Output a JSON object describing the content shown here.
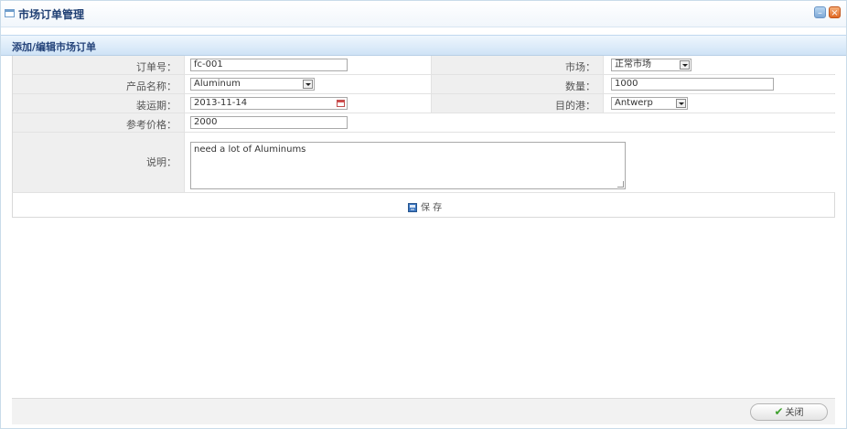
{
  "window": {
    "title": "市场订单管理"
  },
  "section": {
    "title": "添加/编辑市场订单"
  },
  "form": {
    "order_no": {
      "label": "订单号：",
      "value": "fc-001"
    },
    "market": {
      "label": "市场：",
      "value": "正常市场"
    },
    "product": {
      "label": "产品名称：",
      "value": "Aluminum"
    },
    "quantity": {
      "label": "数量：",
      "value": "1000"
    },
    "ship_date": {
      "label": "装运期：",
      "value": "2013-11-14"
    },
    "destination": {
      "label": "目的港：",
      "value": "Antwerp"
    },
    "ref_price": {
      "label": "参考价格：",
      "value": "2000"
    },
    "notes": {
      "label": "说明：",
      "value": "need a lot of Aluminums"
    }
  },
  "actions": {
    "save_label": "保 存",
    "close_label": "关闭"
  },
  "icons": {
    "save": "save-icon",
    "close": "check-icon",
    "calendar": "calendar-icon"
  },
  "colors": {
    "header_blue": "#cfe3f6",
    "title_text": "#1f3f73",
    "label_bg": "#efefef"
  }
}
